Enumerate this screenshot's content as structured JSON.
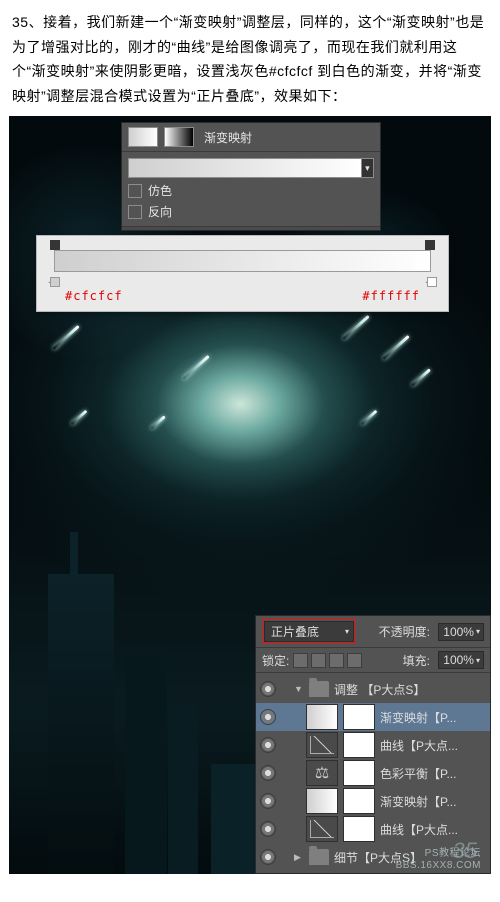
{
  "intro": {
    "text": "35、接着，我们新建一个“渐变映射”调整层，同样的，这个“渐变映射”也是为了增强对比的，刚才的“曲线”是给图像调亮了，而现在我们就利用这个“渐变映射”来使阴影更暗，设置浅灰色#cfcfcf 到白色的渐变，并将“渐变映射”调整层混合模式设置为“正片叠底”，效果如下："
  },
  "gradmap_panel": {
    "title": "渐变映射",
    "dither": "仿色",
    "reverse": "反向"
  },
  "gradient_editor": {
    "left_hex": "#cfcfcf",
    "right_hex": "#ffffff"
  },
  "layers_panel": {
    "blend_mode": "正片叠底",
    "opacity_label": "不透明度:",
    "opacity_value": "100%",
    "lock_label": "锁定:",
    "fill_label": "填充:",
    "fill_value": "100%",
    "groups_and_layers": [
      {
        "type": "group",
        "name": "调整 【P大点S】",
        "open": true
      },
      {
        "type": "layer",
        "name": "渐变映射【P...",
        "thumb": "grad",
        "selected": true,
        "indent": 2
      },
      {
        "type": "layer",
        "name": "曲线【P大点...",
        "thumb": "curves",
        "indent": 2
      },
      {
        "type": "layer",
        "name": "色彩平衡【P...",
        "thumb": "bal",
        "indent": 2
      },
      {
        "type": "layer",
        "name": "渐变映射【P...",
        "thumb": "grad",
        "indent": 2
      },
      {
        "type": "layer",
        "name": "曲线【P大点...",
        "thumb": "curves",
        "indent": 2
      },
      {
        "type": "group",
        "name": "细节【P大点S】",
        "open": false
      }
    ]
  },
  "footer": {
    "page_number": "35",
    "watermark_line1": "PS教程论坛",
    "watermark_line2": "BBS.16XX8.COM"
  }
}
